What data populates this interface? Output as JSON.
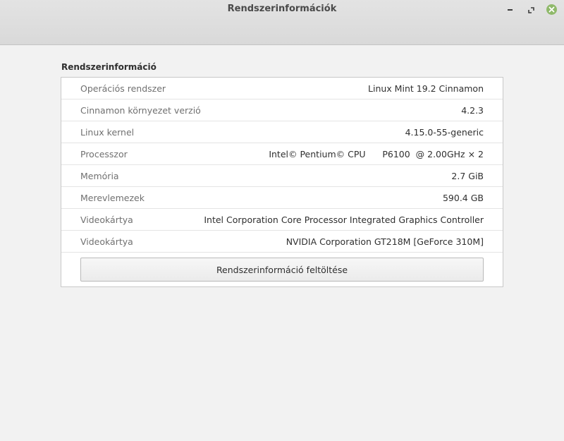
{
  "window": {
    "title": "Rendszerinformációk"
  },
  "section": {
    "title": "Rendszerinformáció"
  },
  "rows": [
    {
      "label": "Operációs rendszer",
      "value": "Linux Mint 19.2 Cinnamon"
    },
    {
      "label": "Cinnamon környezet verzió",
      "value": "4.2.3"
    },
    {
      "label": "Linux kernel",
      "value": "4.15.0-55-generic"
    },
    {
      "label": "Processzor",
      "value": "Intel© Pentium© CPU      P6100  @ 2.00GHz × 2"
    },
    {
      "label": "Memória",
      "value": "2.7 GiB"
    },
    {
      "label": "Merevlemezek",
      "value": "590.4 GB"
    },
    {
      "label": "Videokártya",
      "value": "Intel Corporation Core Processor Integrated Graphics Controller"
    },
    {
      "label": "Videokártya",
      "value": "NVIDIA Corporation GT218M [GeForce 310M]"
    }
  ],
  "upload_button": {
    "label": "Rendszerinformáció feltöltése"
  },
  "icons": {
    "minimize": "minimize-icon",
    "maximize": "maximize-icon",
    "close": "close-icon"
  },
  "colors": {
    "close_button": "#8fb96a"
  }
}
